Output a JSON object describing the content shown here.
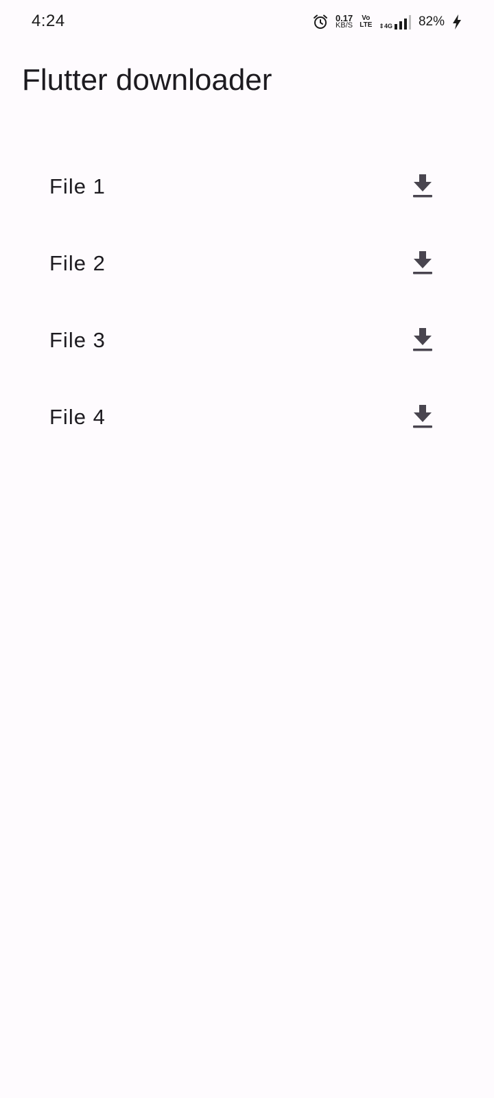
{
  "status_bar": {
    "time": "4:24",
    "net_speed_value": "0.17",
    "net_speed_unit": "KB/S",
    "volte_top": "Vo",
    "volte_bottom": "LTE",
    "network_type": "4G",
    "battery": "82%"
  },
  "app": {
    "title": "Flutter downloader"
  },
  "files": [
    {
      "label": "File 1",
      "icon": "download-icon"
    },
    {
      "label": "File 2",
      "icon": "download-icon"
    },
    {
      "label": "File 3",
      "icon": "download-icon"
    },
    {
      "label": "File 4",
      "icon": "download-icon"
    }
  ],
  "colors": {
    "background": "#fefbfe",
    "text": "#1d1b20",
    "icon": "#49454f"
  }
}
